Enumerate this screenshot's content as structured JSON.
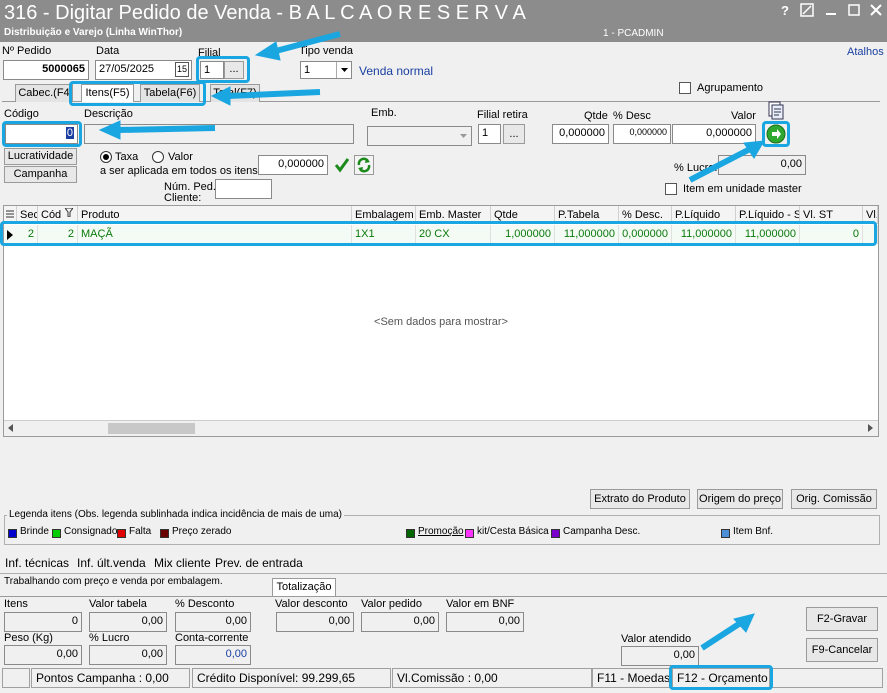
{
  "window": {
    "title": "316 - Digitar Pedido de Venda - B A L C A O  R E S E R V A",
    "subtitle": "Distribuição e Varejo (Linha WinThor)",
    "user": "1 - PCADMIN",
    "help_label": "?",
    "atalhos": "Atalhos"
  },
  "header": {
    "pedido_label": "Nº Pedido",
    "pedido_value": "5000065",
    "data_label": "Data",
    "data_value": "27/05/2025",
    "cal_label": "15",
    "filial_label": "Filial",
    "filial_value": "1",
    "filial_btn": "...",
    "tipo_venda_label": "Tipo venda",
    "tipo_venda_value": "1",
    "tipo_venda_desc": "Venda normal",
    "agrupamento_label": "Agrupamento"
  },
  "tabs": [
    {
      "label": "Cabec.(F4"
    },
    {
      "label": "Itens(F5)"
    },
    {
      "label": "Tabela(F6)"
    },
    {
      "label": "Total(F7)"
    }
  ],
  "item_form": {
    "codigo_label": "Código",
    "codigo_value": "0",
    "descricao_label": "Descrição",
    "emb_label": "Emb.",
    "filial_retira_label": "Filial retira",
    "filial_retira_value": "1",
    "filial_retira_btn": "...",
    "qtde_label": "Qtde",
    "qtde_value": "0,000000",
    "desc_label": "% Desc",
    "desc_value": "0,000000",
    "valor_label": "Valor",
    "valor_value": "0,000000",
    "lucratividade_btn": "Lucratividade",
    "campanha_btn": "Campanha",
    "taxa_label": "Taxa",
    "valor_radio_label": "Valor",
    "aplicada_label": "a ser aplicada em todos os itens:",
    "aplicada_value": "0,000000",
    "num_ped_label": "Núm. Ped.",
    "cliente_label": "Cliente:",
    "lucro_label": "% Lucro:",
    "lucro_value": "0,00",
    "item_master_label": "Item em unidade master"
  },
  "grid": {
    "columns": [
      "Sec",
      "Cód",
      "Produto",
      "Embalagem",
      "Emb. Master",
      "Qtde",
      "P.Tabela",
      "% Desc.",
      "P.Líquido",
      "P.Líquido - S",
      "Vl. ST",
      "Vl."
    ],
    "rows": [
      {
        "sec": "2",
        "cod": "2",
        "produto": "MAÇÃ",
        "embalagem": "1X1",
        "emb_master": "20 CX",
        "qtde": "1,000000",
        "p_tabela": "11,000000",
        "desc": "0,000000",
        "p_liquido": "11,000000",
        "p_liquido_s": "11,000000",
        "vl_st": "0",
        "vl": ""
      }
    ],
    "empty_text": "<Sem dados para mostrar>"
  },
  "buttons": {
    "extrato": "Extrato do Produto",
    "origem": "Origem do preço",
    "orig_comissao": "Orig. Comissão",
    "gravar": "F2-Gravar",
    "cancelar": "F9-Cancelar"
  },
  "legend": {
    "title": "Legenda itens (Obs. legenda sublinhada indica incidência de mais de uma)",
    "items": [
      {
        "label": "Brinde",
        "color": "#0000cc"
      },
      {
        "label": "Consignado",
        "color": "#00cc00"
      },
      {
        "label": "Falta",
        "color": "#e00000"
      },
      {
        "label": "Preço zerado",
        "color": "#6b0000"
      },
      {
        "label": "Promoção",
        "color": "#006600"
      },
      {
        "label": "kit/Cesta Básica",
        "color": "#ff33ff"
      },
      {
        "label": "Campanha Desc.",
        "color": "#7a00cc"
      },
      {
        "label": "Item Bnf.",
        "color": "#4a8fd8"
      }
    ]
  },
  "bottom_links": [
    "Inf. técnicas",
    "Inf. últ.venda",
    "Mix cliente",
    "Prev. de entrada"
  ],
  "working_text": "Trabalhando com preço e venda por embalagem.",
  "totalizacao": {
    "tab_label": "Totalização",
    "itens_label": "Itens",
    "itens_value": "0",
    "valor_tabela_label": "Valor tabela",
    "valor_tabela_value": "0,00",
    "pct_desconto_label": "% Desconto",
    "pct_desconto_value": "0,00",
    "valor_desconto_label": "Valor desconto",
    "valor_desconto_value": "0,00",
    "valor_pedido_label": "Valor pedido",
    "valor_pedido_value": "0,00",
    "valor_bnf_label": "Valor em BNF",
    "valor_bnf_value": "0,00",
    "peso_label": "Peso (Kg)",
    "peso_value": "0,00",
    "pct_lucro_label": "% Lucro",
    "pct_lucro_value": "0,00",
    "conta_corrente_label": "Conta-corrente",
    "conta_corrente_value": "0,00",
    "valor_atendido_label": "Valor atendido",
    "valor_atendido_value": "0,00"
  },
  "status": {
    "pontos": "Pontos Campanha : 0,00",
    "credito": "Crédito Disponível: 99.299,65",
    "comissao": "Vl.Comissão : 0,00",
    "f11": "F11 - Moedas",
    "f12": "F12 - Orçamento"
  },
  "colors": {
    "accent": "#1aa6e0",
    "title_bg": "#8c8c8c",
    "grid_text": "#0a7a0a"
  }
}
